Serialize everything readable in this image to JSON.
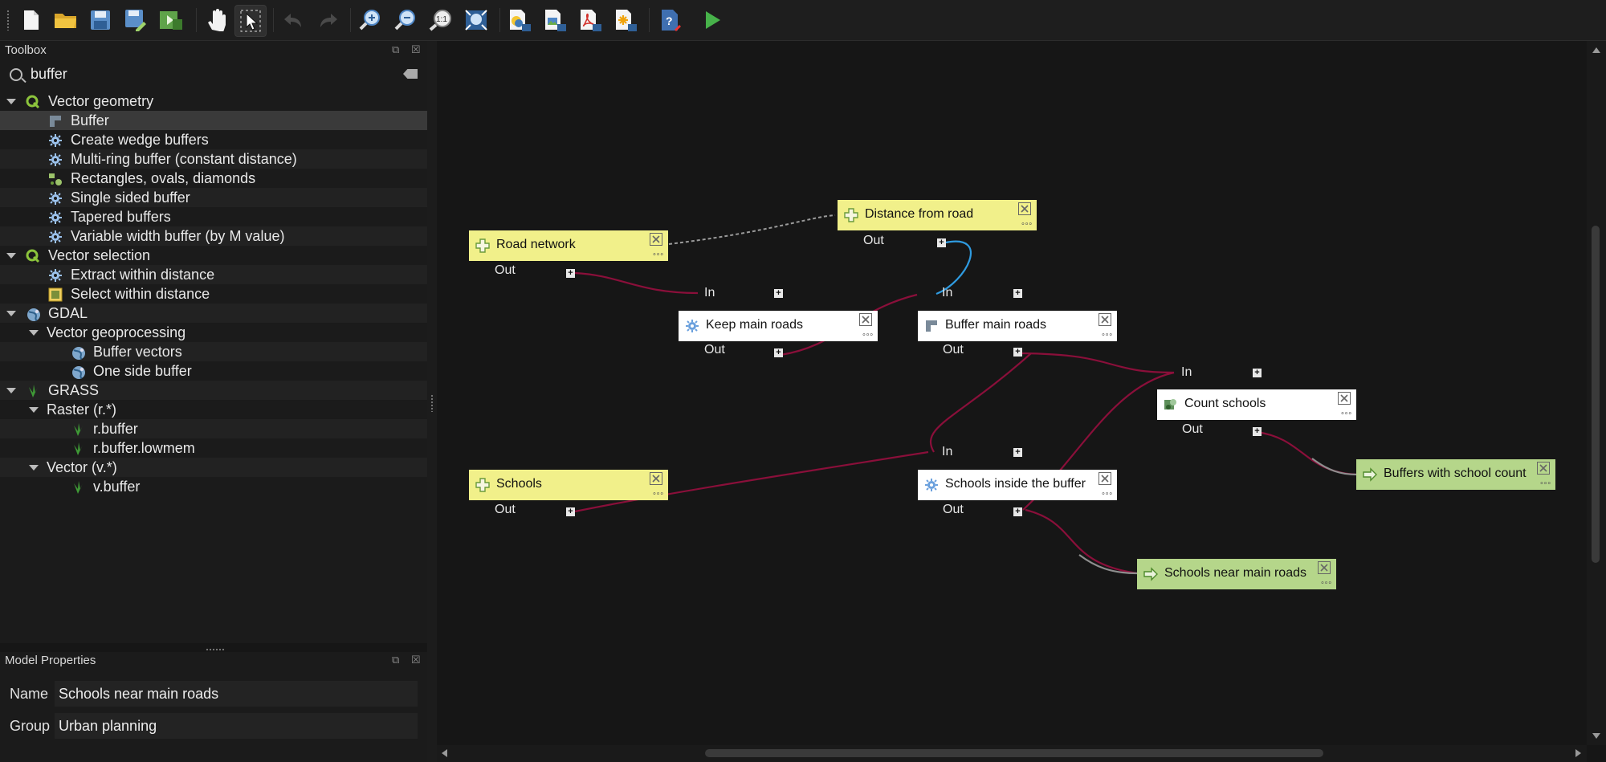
{
  "toolbar": {
    "buttons": [
      {
        "name": "new-model-icon"
      },
      {
        "name": "open-model-icon"
      },
      {
        "name": "save-model-icon"
      },
      {
        "name": "save-as-icon"
      },
      {
        "name": "save-in-project-icon"
      },
      {
        "name": "pan-icon"
      },
      {
        "name": "select-icon"
      },
      {
        "name": "undo-icon"
      },
      {
        "name": "redo-icon"
      },
      {
        "name": "zoom-in-icon"
      },
      {
        "name": "zoom-out-icon"
      },
      {
        "name": "zoom-actual-icon"
      },
      {
        "name": "zoom-full-icon"
      },
      {
        "name": "export-python-icon"
      },
      {
        "name": "export-image-icon"
      },
      {
        "name": "export-pdf-icon"
      },
      {
        "name": "export-svg-icon"
      },
      {
        "name": "help-icon"
      },
      {
        "name": "run-model-icon"
      }
    ]
  },
  "toolbox": {
    "title": "Toolbox",
    "search_value": "buffer",
    "tree": [
      {
        "label": "Vector geometry",
        "level": 0,
        "icon": "qgis-logo-icon",
        "expanded": true
      },
      {
        "label": "Buffer",
        "level": 1,
        "icon": "buffer-icon",
        "selected": true
      },
      {
        "label": "Create wedge buffers",
        "level": 1,
        "icon": "gear-icon"
      },
      {
        "label": "Multi-ring buffer (constant distance)",
        "level": 1,
        "icon": "gear-icon"
      },
      {
        "label": "Rectangles, ovals, diamonds",
        "level": 1,
        "icon": "shapes-icon"
      },
      {
        "label": "Single sided buffer",
        "level": 1,
        "icon": "gear-icon"
      },
      {
        "label": "Tapered buffers",
        "level": 1,
        "icon": "gear-icon"
      },
      {
        "label": "Variable width buffer (by M value)",
        "level": 1,
        "icon": "gear-icon"
      },
      {
        "label": "Vector selection",
        "level": 0,
        "icon": "qgis-logo-icon",
        "expanded": true
      },
      {
        "label": "Extract within distance",
        "level": 1,
        "icon": "gear-icon"
      },
      {
        "label": "Select within distance",
        "level": 1,
        "icon": "select-square-icon"
      },
      {
        "label": "GDAL",
        "level": 0,
        "icon": "gdal-globe-icon",
        "expanded": true
      },
      {
        "label": "Vector geoprocessing",
        "level": 1,
        "icon": "",
        "expanded": true
      },
      {
        "label": "Buffer vectors",
        "level": 2,
        "icon": "gdal-globe-icon"
      },
      {
        "label": "One side buffer",
        "level": 2,
        "icon": "gdal-globe-icon"
      },
      {
        "label": "GRASS",
        "level": 0,
        "icon": "grass-icon",
        "expanded": true
      },
      {
        "label": "Raster (r.*)",
        "level": 1,
        "icon": "",
        "expanded": true
      },
      {
        "label": "r.buffer",
        "level": 2,
        "icon": "grass-icon"
      },
      {
        "label": "r.buffer.lowmem",
        "level": 2,
        "icon": "grass-icon"
      },
      {
        "label": "Vector (v.*)",
        "level": 1,
        "icon": "",
        "expanded": true
      },
      {
        "label": "v.buffer",
        "level": 2,
        "icon": "grass-icon"
      }
    ]
  },
  "properties": {
    "title": "Model Properties",
    "name_label": "Name",
    "name_value": "Schools near main roads",
    "group_label": "Group",
    "group_value": "Urban planning"
  },
  "model": {
    "colors": {
      "input": "#f1f08a",
      "algorithm": "#ffffff",
      "output": "#b5d68a",
      "link": "#8a0f3a",
      "link_highlight": "#2f9be0"
    },
    "port_in": "In",
    "port_out": "Out",
    "nodes": {
      "road_network": {
        "label": "Road network",
        "type": "input"
      },
      "distance_from_road": {
        "label": "Distance from road",
        "type": "input"
      },
      "schools": {
        "label": "Schools",
        "type": "input"
      },
      "keep_main_roads": {
        "label": "Keep main roads",
        "type": "algorithm"
      },
      "buffer_main_roads": {
        "label": "Buffer main roads",
        "type": "algorithm"
      },
      "schools_inside_buffer": {
        "label": "Schools inside the buffer",
        "type": "algorithm"
      },
      "count_schools": {
        "label": "Count schools",
        "type": "algorithm"
      },
      "buffers_with_school_count": {
        "label": "Buffers with school count",
        "type": "output"
      },
      "schools_near_main_roads": {
        "label": "Schools near main roads",
        "type": "output"
      }
    }
  }
}
